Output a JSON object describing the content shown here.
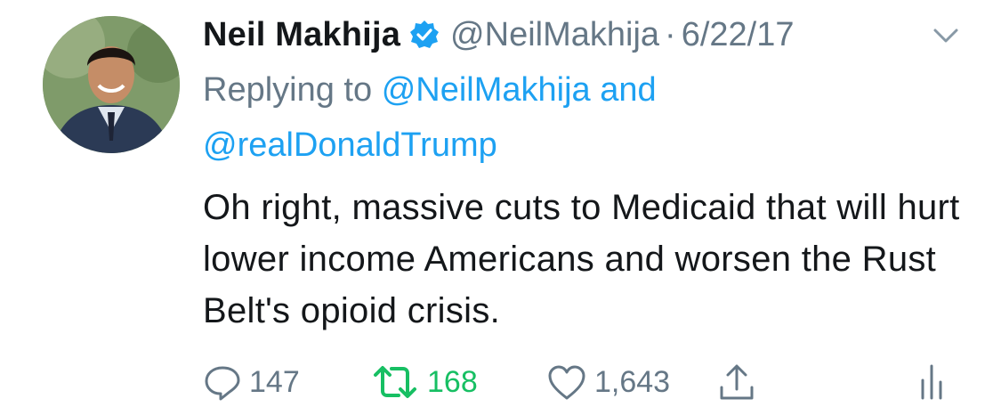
{
  "tweet": {
    "display_name": "Neil Makhija",
    "handle": "@NeilMakhija",
    "separator": "·",
    "timestamp": "6/22/17",
    "reply_prefix": "Replying to",
    "reply_mention_1": "@NeilMakhija",
    "reply_conjunction": "and",
    "reply_mention_2": "@realDonaldTrump",
    "text": "Oh right, massive cuts to Medicaid that will hurt lower income Americans and worsen the Rust Belt's opioid crisis.",
    "reply_count": "147",
    "retweet_count": "168",
    "like_count": "1,643"
  },
  "icons": {
    "verified": "verified-badge-icon",
    "caret": "chevron-down-icon",
    "reply": "reply-bubble-icon",
    "retweet": "retweet-icon",
    "like": "heart-icon",
    "share": "share-icon",
    "analytics": "analytics-icon"
  },
  "colors": {
    "text": "#14171a",
    "muted": "#657786",
    "link": "#1da1f2",
    "retweet_active": "#17bf63"
  }
}
